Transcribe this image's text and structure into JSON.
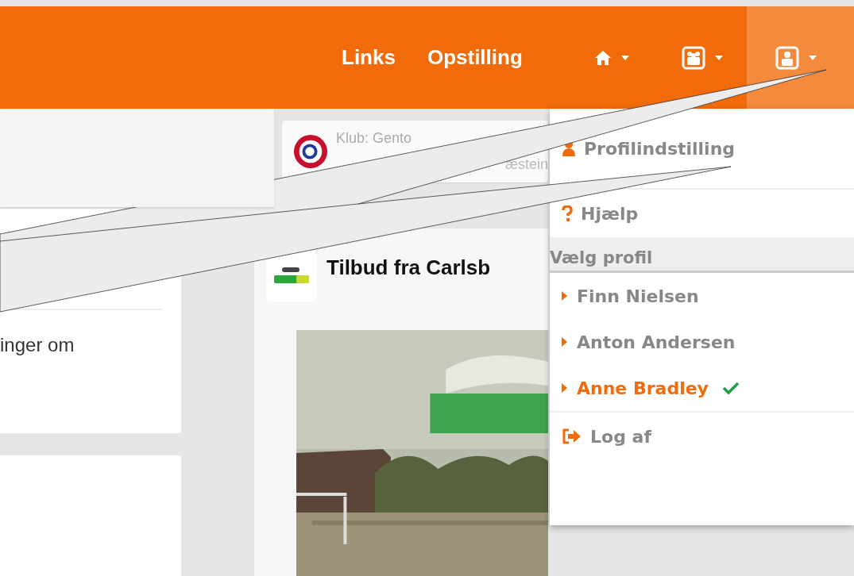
{
  "nav": {
    "links": [
      {
        "label": "Links"
      },
      {
        "label": "Opstilling"
      }
    ],
    "icons": [
      {
        "kind": "home",
        "selected": false
      },
      {
        "kind": "group",
        "selected": false
      },
      {
        "kind": "person",
        "selected": true
      }
    ]
  },
  "club_card": {
    "line1": "Klub: Gento",
    "line2": "æstein"
  },
  "left_cards": [
    {
      "text": "inger om"
    }
  ],
  "offer_card": {
    "title": "Tilbud fra Carlsb"
  },
  "dropdown": [
    {
      "kind": "settings",
      "label": "Profilindstilling"
    },
    {
      "kind": "divider"
    },
    {
      "kind": "help",
      "label": "Hjælp"
    },
    {
      "kind": "header",
      "label": "Vælg profil"
    },
    {
      "kind": "profile",
      "label": "Finn Nielsen",
      "selected": false
    },
    {
      "kind": "profile",
      "label": "Anton Andersen",
      "selected": false
    },
    {
      "kind": "profile",
      "label": "Anne Bradley",
      "selected": true
    },
    {
      "kind": "divider"
    },
    {
      "kind": "logout",
      "label": "Log af"
    }
  ]
}
